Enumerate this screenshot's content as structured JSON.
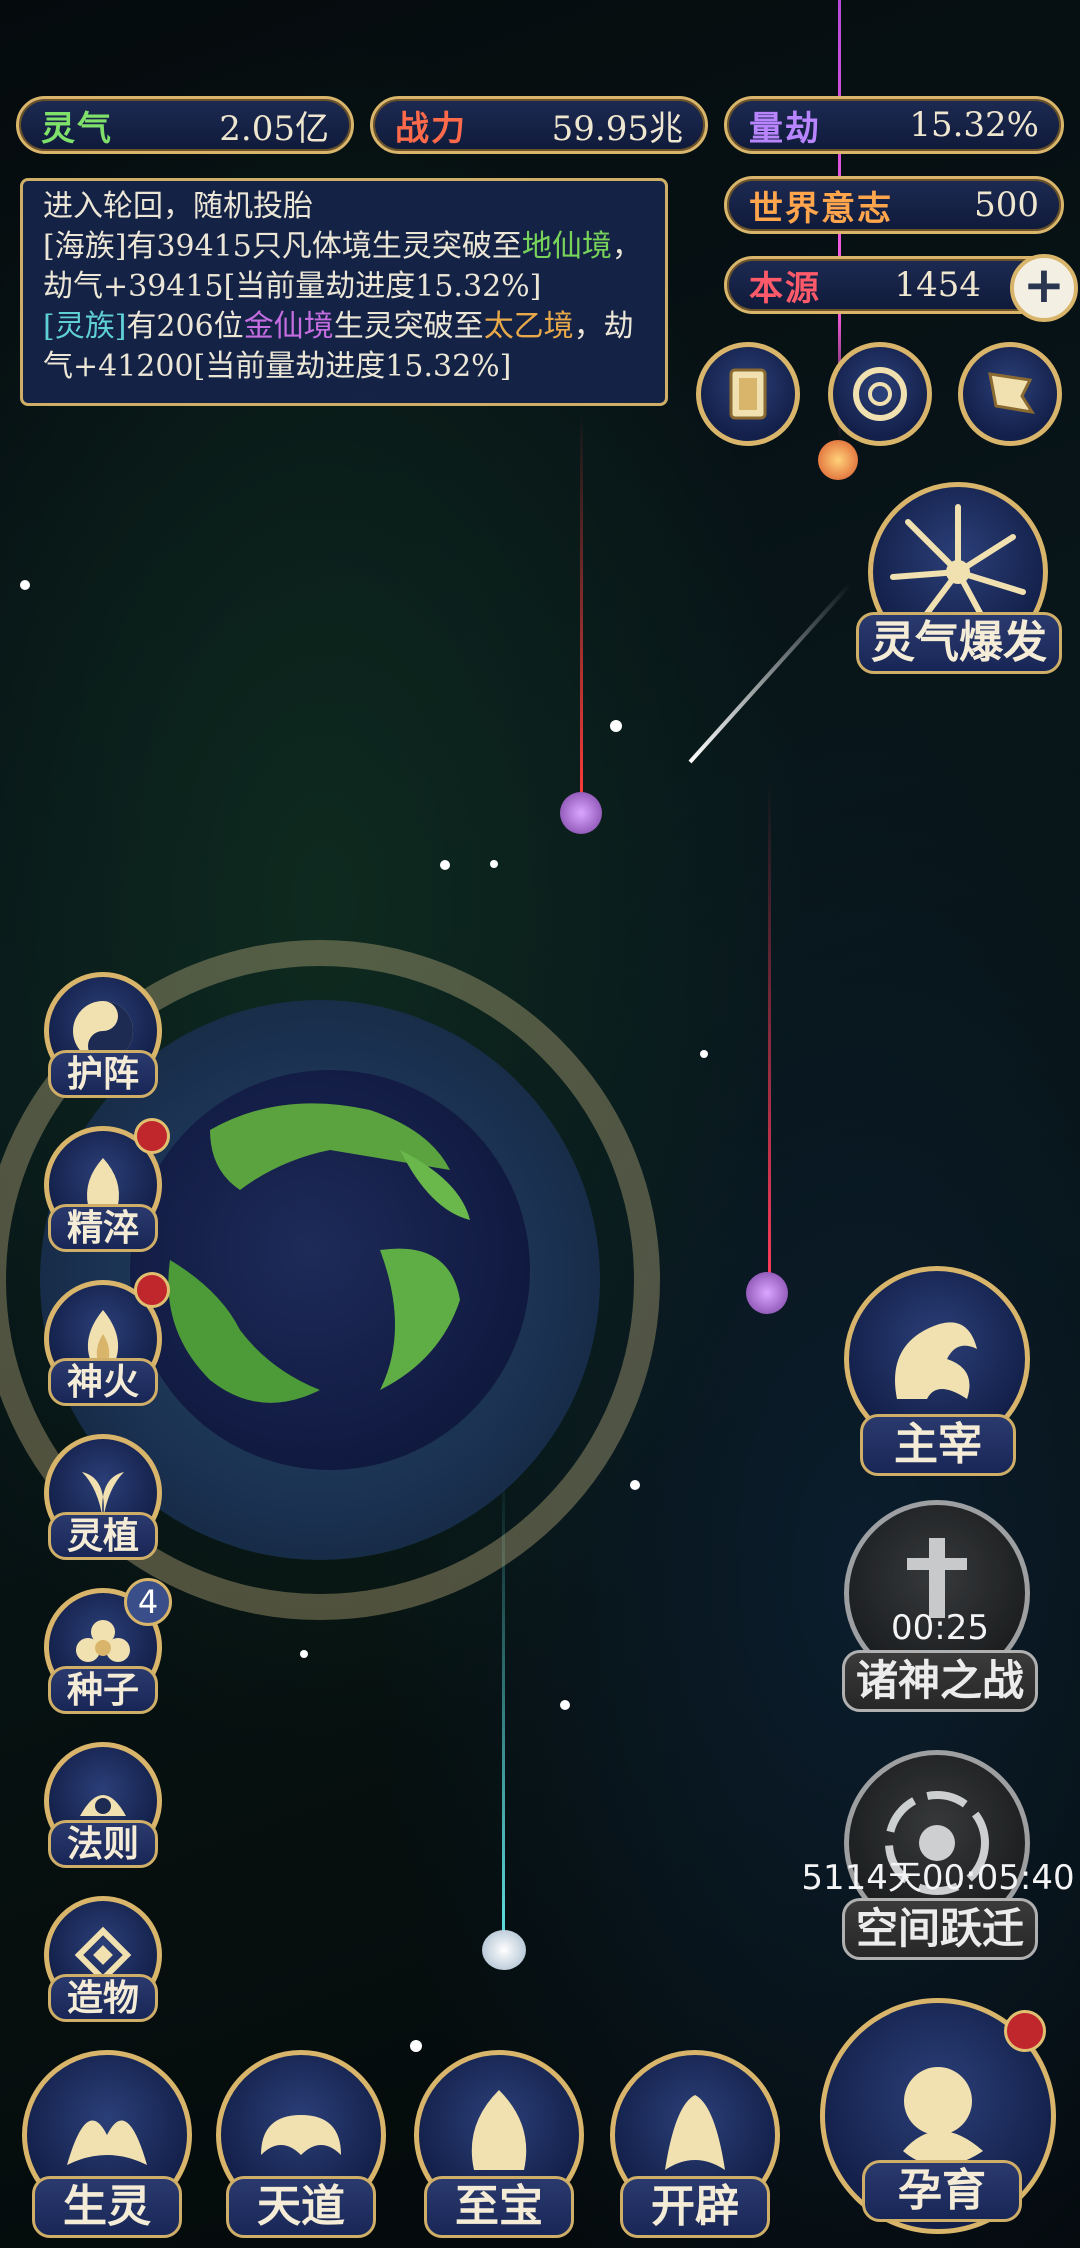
{
  "resources": {
    "lingqi": {
      "label": "灵气",
      "value": "2.05亿"
    },
    "zhanli": {
      "label": "战力",
      "value": "59.95兆"
    },
    "liangjie": {
      "label": "量劫",
      "value": "15.32%"
    },
    "shijie": {
      "label": "世界意志",
      "value": "500"
    },
    "benyuan": {
      "label": "本源",
      "value": "1454"
    }
  },
  "log": {
    "line1": "进入轮回，随机投胎",
    "e1_a": "[海族]有39415只凡体境生灵突破至",
    "e1_realm": "地仙境",
    "e1_b": "，劫气+39415[当前量劫进度15.32%]",
    "e2_race": "[灵族]",
    "e2_a": "有206位",
    "e2_realm1": "金仙境",
    "e2_b": "生灵突破至",
    "e2_realm2": "太乙境",
    "e2_c": "，劫气+41200[当前量劫进度15.32%]"
  },
  "right_buttons": {
    "burst": "灵气爆发",
    "master": "主宰",
    "godwar": "诸神之战",
    "godwar_timer": "00:25",
    "jump": "空间跃迁",
    "jump_timer": "5114天00:05:40"
  },
  "left_buttons": [
    "护阵",
    "精淬",
    "神火",
    "灵植",
    "种子",
    "法则",
    "造物"
  ],
  "seed_badge": "4",
  "bottom_buttons": [
    "生灵",
    "天道",
    "至宝",
    "开辟",
    "孕育"
  ],
  "colors": {
    "gold": "#d8b56a",
    "panel": "#16244a",
    "red_dot": "#c0272d"
  }
}
